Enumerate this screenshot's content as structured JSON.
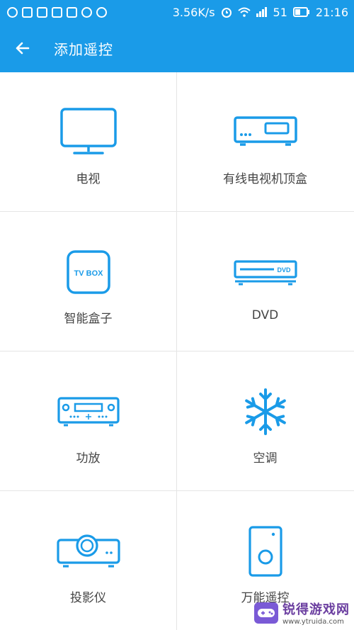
{
  "statusbar": {
    "left_icons": [
      "notification-q-icon",
      "image-icon",
      "app-grid-icon",
      "video-icon",
      "file-icon",
      "cloud-icon",
      "more-icon"
    ],
    "speed": "3.56K/s",
    "signal": "51",
    "time": "21:16"
  },
  "appbar": {
    "title": "添加遥控"
  },
  "devices": [
    {
      "label": "电视",
      "icon": "tv-icon"
    },
    {
      "label": "有线电视机顶盒",
      "icon": "set-top-box-icon"
    },
    {
      "label": "智能盒子",
      "icon": "tv-box-icon",
      "icon_text": "TV BOX"
    },
    {
      "label": "DVD",
      "icon": "dvd-player-icon",
      "icon_text": "DVD"
    },
    {
      "label": "功放",
      "icon": "amplifier-icon"
    },
    {
      "label": "空调",
      "icon": "snowflake-icon"
    },
    {
      "label": "投影仪",
      "icon": "projector-icon"
    },
    {
      "label": "万能遥控",
      "icon": "universal-remote-icon"
    }
  ],
  "watermark": {
    "name": "锐得游戏网",
    "url": "www.ytruida.com"
  },
  "colors": {
    "primary": "#1a9be8",
    "text": "#444444",
    "divider": "#e5e5e5"
  }
}
